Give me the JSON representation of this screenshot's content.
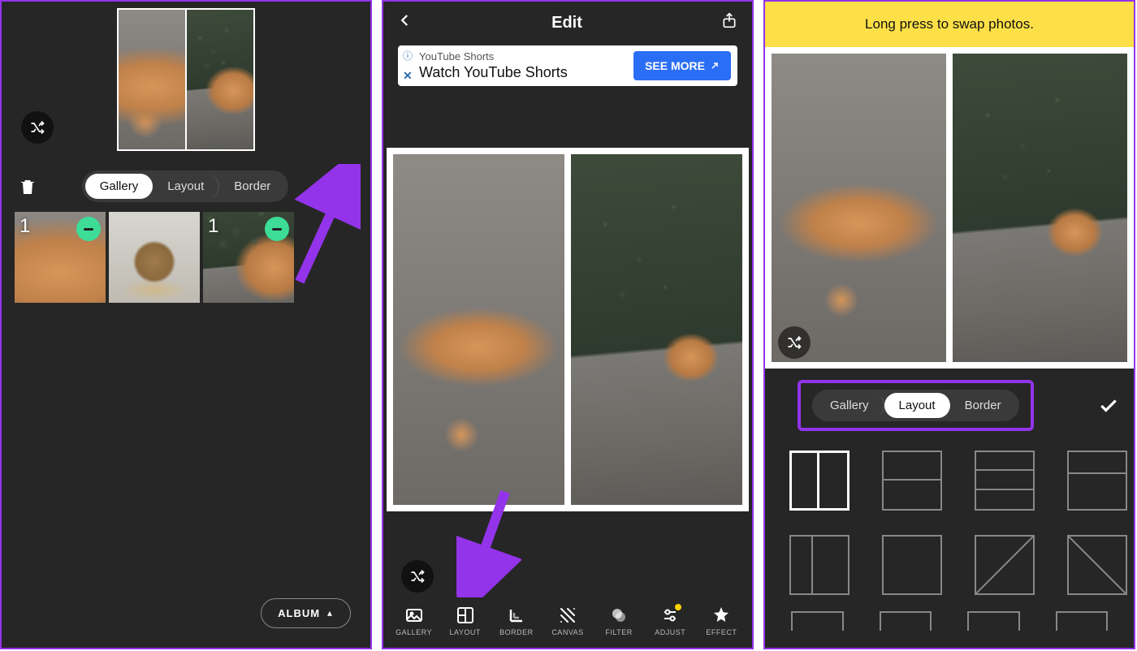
{
  "colors": {
    "accent": "#9333ea",
    "mint": "#3ddc97",
    "banner": "#fde047",
    "cta": "#2b6ef6"
  },
  "pane1": {
    "tabs": {
      "gallery": "Gallery",
      "layout": "Layout",
      "border": "Border",
      "active": "gallery"
    },
    "thumbs": [
      {
        "num": "1",
        "has_minus": true,
        "dim": true
      },
      {
        "num": "",
        "has_minus": false,
        "dim": false
      },
      {
        "num": "1",
        "has_minus": true,
        "dim": true
      }
    ],
    "album_label": "ALBUM"
  },
  "pane2": {
    "title": "Edit",
    "ad": {
      "subtitle": "YouTube Shorts",
      "title": "Watch YouTube Shorts",
      "cta": "SEE MORE"
    },
    "nav": [
      {
        "label": "GALLERY",
        "icon": "image-icon"
      },
      {
        "label": "LAYOUT",
        "icon": "layout-icon"
      },
      {
        "label": "BORDER",
        "icon": "border-icon"
      },
      {
        "label": "CANVAS",
        "icon": "canvas-icon"
      },
      {
        "label": "FILTER",
        "icon": "filter-icon"
      },
      {
        "label": "ADJUST",
        "icon": "adjust-icon",
        "dot": true
      },
      {
        "label": "EFFECT",
        "icon": "effect-icon"
      }
    ]
  },
  "pane3": {
    "banner": "Long press to swap photos.",
    "tabs": {
      "gallery": "Gallery",
      "layout": "Layout",
      "border": "Border",
      "active": "layout"
    },
    "layouts": [
      {
        "type": "v2",
        "active": true
      },
      {
        "type": "h2"
      },
      {
        "type": "h3"
      },
      {
        "type": "h2v"
      },
      {
        "type": "v2b"
      },
      {
        "type": "single"
      },
      {
        "type": "diag1"
      },
      {
        "type": "diag2"
      }
    ]
  }
}
